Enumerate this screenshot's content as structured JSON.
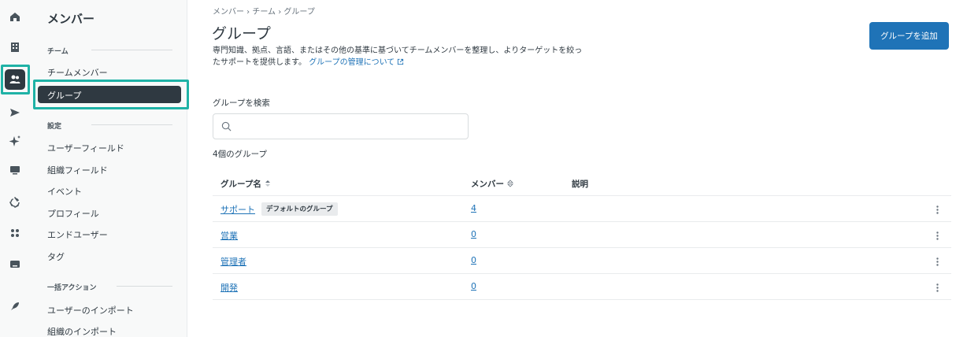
{
  "rail": {
    "icons": [
      "home-icon",
      "building-icon",
      "people-icon",
      "send-icon",
      "sparkle-icon",
      "monitor-icon",
      "recycle-icon",
      "grid-icon",
      "inbox-icon",
      "rocket-icon"
    ]
  },
  "subnav": {
    "title": "メンバー",
    "sections": [
      {
        "label": "チーム",
        "items": [
          "チームメンバー",
          "グループ"
        ]
      },
      {
        "label": "設定",
        "items": [
          "ユーザーフィールド",
          "組織フィールド",
          "イベント",
          "プロフィール",
          "エンドユーザー",
          "タグ"
        ]
      },
      {
        "label": "一括アクション",
        "items": [
          "ユーザーのインポート",
          "組織のインポート"
        ]
      }
    ],
    "active_item": "グループ"
  },
  "main": {
    "breadcrumb": "メンバー › チーム › グループ",
    "title": "グループ",
    "description": "専門知識、拠点、言語、またはその他の基準に基づいてチームメンバーを整理し、よりターゲットを絞ったサポートを提供します。",
    "learn_more": "グループの管理について",
    "add_button": "グループを追加",
    "search_label": "グループを検索",
    "search_value": "",
    "count_text": "4個のグループ",
    "table": {
      "columns": [
        "グループ名",
        "メンバー",
        "説明"
      ],
      "rows": [
        {
          "name": "サポート",
          "badge": "デフォルトのグループ",
          "members": "4",
          "description": ""
        },
        {
          "name": "営業",
          "badge": "",
          "members": "0",
          "description": ""
        },
        {
          "name": "管理者",
          "badge": "",
          "members": "0",
          "description": ""
        },
        {
          "name": "開発",
          "badge": "",
          "members": "0",
          "description": ""
        }
      ]
    }
  },
  "colors": {
    "accent": "#1f73b7",
    "highlight": "#1fb2a6",
    "active_nav": "#2f3941"
  }
}
